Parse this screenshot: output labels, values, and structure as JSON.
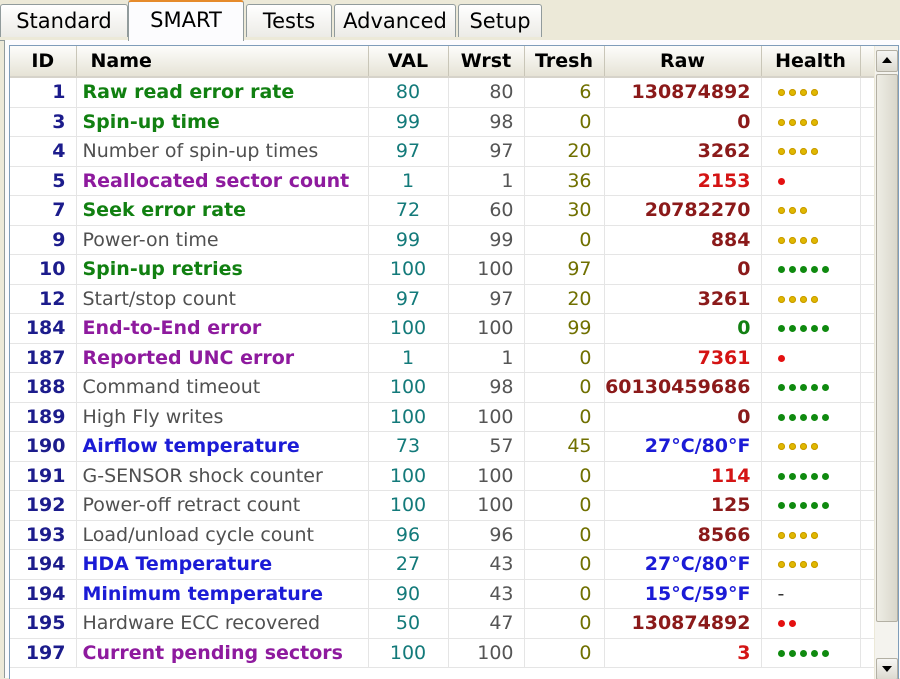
{
  "tabs": [
    {
      "label": "Standard"
    },
    {
      "label": "SMART"
    },
    {
      "label": "Tests"
    },
    {
      "label": "Advanced"
    },
    {
      "label": "Setup"
    }
  ],
  "active_tab": "SMART",
  "columns": {
    "id": "ID",
    "name": "Name",
    "val": "VAL",
    "wrst": "Wrst",
    "tresh": "Tresh",
    "raw": "Raw",
    "health": "Health"
  },
  "colors": {
    "ok": "#118011",
    "info": "#505050",
    "critical": "#8e1a9e",
    "temperature": "#1b1bd6",
    "health_yellow": "#e0b800",
    "health_green": "#0f8a0f",
    "health_red": "#e41010"
  },
  "rows": [
    {
      "id": "1",
      "name": "Raw read error rate",
      "name_style": "green",
      "val": "80",
      "wrst": "80",
      "tresh": "6",
      "raw": "130874892",
      "raw_style": "dark",
      "health": "yellow",
      "health_level": 4
    },
    {
      "id": "3",
      "name": "Spin-up time",
      "name_style": "green",
      "val": "99",
      "wrst": "98",
      "tresh": "0",
      "raw": "0",
      "raw_style": "dark",
      "health": "yellow",
      "health_level": 4
    },
    {
      "id": "4",
      "name": "Number of spin-up times",
      "name_style": "gray",
      "val": "97",
      "wrst": "97",
      "tresh": "20",
      "raw": "3262",
      "raw_style": "dark",
      "health": "yellow",
      "health_level": 4
    },
    {
      "id": "5",
      "name": "Reallocated sector count",
      "name_style": "purple",
      "val": "1",
      "wrst": "1",
      "tresh": "36",
      "raw": "2153",
      "raw_style": "red",
      "health": "red",
      "health_level": 1
    },
    {
      "id": "7",
      "name": "Seek error rate",
      "name_style": "green",
      "val": "72",
      "wrst": "60",
      "tresh": "30",
      "raw": "20782270",
      "raw_style": "dark",
      "health": "yellow",
      "health_level": 3
    },
    {
      "id": "9",
      "name": "Power-on time",
      "name_style": "gray",
      "val": "99",
      "wrst": "99",
      "tresh": "0",
      "raw": "884",
      "raw_style": "dark",
      "health": "yellow",
      "health_level": 4
    },
    {
      "id": "10",
      "name": "Spin-up retries",
      "name_style": "green",
      "val": "100",
      "wrst": "100",
      "tresh": "97",
      "raw": "0",
      "raw_style": "dark",
      "health": "green",
      "health_level": 5
    },
    {
      "id": "12",
      "name": "Start/stop count",
      "name_style": "gray",
      "val": "97",
      "wrst": "97",
      "tresh": "20",
      "raw": "3261",
      "raw_style": "dark",
      "health": "yellow",
      "health_level": 4
    },
    {
      "id": "184",
      "name": "End-to-End error",
      "name_style": "purple",
      "val": "100",
      "wrst": "100",
      "tresh": "99",
      "raw": "0",
      "raw_style": "green",
      "health": "green",
      "health_level": 5
    },
    {
      "id": "187",
      "name": "Reported UNC error",
      "name_style": "purple",
      "val": "1",
      "wrst": "1",
      "tresh": "0",
      "raw": "7361",
      "raw_style": "red",
      "health": "red",
      "health_level": 1
    },
    {
      "id": "188",
      "name": "Command timeout",
      "name_style": "gray",
      "val": "100",
      "wrst": "98",
      "tresh": "0",
      "raw": "60130459686",
      "raw_style": "dark",
      "health": "green",
      "health_level": 5
    },
    {
      "id": "189",
      "name": "High Fly writes",
      "name_style": "gray",
      "val": "100",
      "wrst": "100",
      "tresh": "0",
      "raw": "0",
      "raw_style": "dark",
      "health": "green",
      "health_level": 5
    },
    {
      "id": "190",
      "name": "Airflow temperature",
      "name_style": "blue",
      "val": "73",
      "wrst": "57",
      "tresh": "45",
      "raw": "27°C/80°F",
      "raw_style": "blue",
      "health": "yellow",
      "health_level": 4
    },
    {
      "id": "191",
      "name": "G-SENSOR shock counter",
      "name_style": "gray",
      "val": "100",
      "wrst": "100",
      "tresh": "0",
      "raw": "114",
      "raw_style": "red",
      "health": "green",
      "health_level": 5
    },
    {
      "id": "192",
      "name": "Power-off retract count",
      "name_style": "gray",
      "val": "100",
      "wrst": "100",
      "tresh": "0",
      "raw": "125",
      "raw_style": "dark",
      "health": "green",
      "health_level": 5
    },
    {
      "id": "193",
      "name": "Load/unload cycle count",
      "name_style": "gray",
      "val": "96",
      "wrst": "96",
      "tresh": "0",
      "raw": "8566",
      "raw_style": "dark",
      "health": "yellow",
      "health_level": 4
    },
    {
      "id": "194",
      "name": "HDA Temperature",
      "name_style": "blue",
      "val": "27",
      "wrst": "43",
      "tresh": "0",
      "raw": "27°C/80°F",
      "raw_style": "blue",
      "health": "yellow",
      "health_level": 4
    },
    {
      "id": "194",
      "name": "Minimum temperature",
      "name_style": "blue",
      "val": "90",
      "wrst": "43",
      "tresh": "0",
      "raw": "15°C/59°F",
      "raw_style": "blue",
      "health": "none",
      "health_level": 0,
      "health_text": "-"
    },
    {
      "id": "195",
      "name": "Hardware ECC recovered",
      "name_style": "gray",
      "val": "50",
      "wrst": "47",
      "tresh": "0",
      "raw": "130874892",
      "raw_style": "dark",
      "health": "red",
      "health_level": 2
    },
    {
      "id": "197",
      "name": "Current pending sectors",
      "name_style": "purple",
      "val": "100",
      "wrst": "100",
      "tresh": "0",
      "raw": "3",
      "raw_style": "red",
      "health": "green",
      "health_level": 5
    }
  ]
}
